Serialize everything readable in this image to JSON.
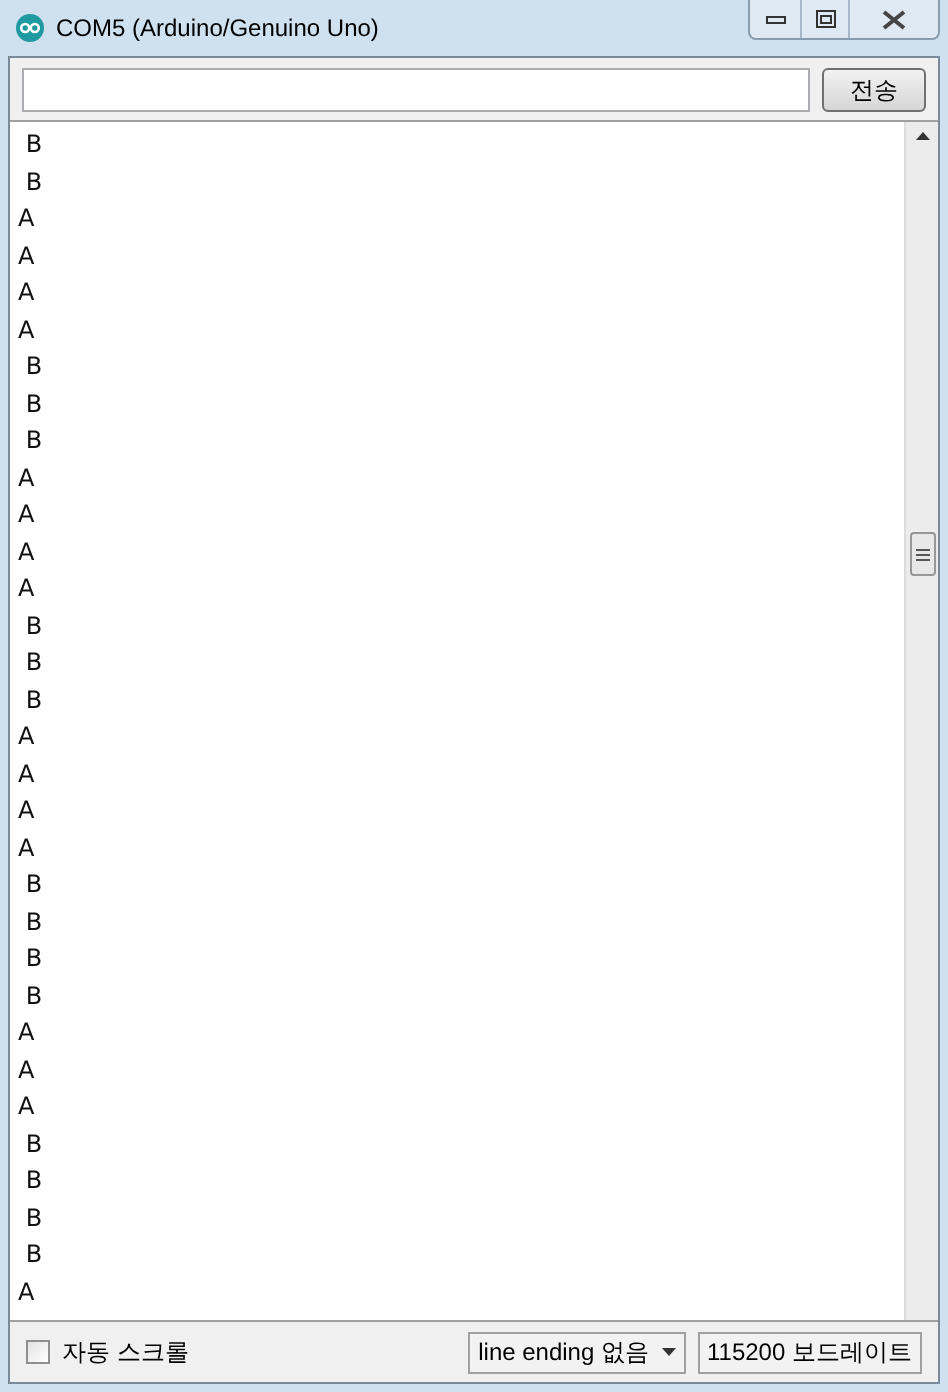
{
  "window": {
    "title": "COM5 (Arduino/Genuino Uno)"
  },
  "send": {
    "button": "전송"
  },
  "output": {
    "lines": [
      " B",
      " B",
      "A",
      "A",
      "A",
      "A",
      " B",
      " B",
      " B",
      "A",
      "A",
      "A",
      "A",
      " B",
      " B",
      " B",
      "A",
      "A",
      "A",
      "A",
      " B",
      " B",
      " B",
      " B",
      "A",
      "A",
      "A",
      " B",
      " B",
      " B",
      " B",
      "A"
    ]
  },
  "status_bar": {
    "autoscroll": {
      "label": "자동 스크롤",
      "checked": false
    },
    "line_ending": "line ending 없음",
    "baud": "115200 보드레이트"
  }
}
